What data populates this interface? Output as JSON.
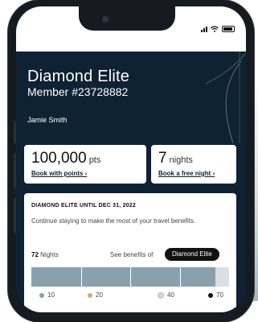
{
  "member": {
    "tier_name": "Diamond Elite",
    "member_number": "Member #23728882",
    "name": "Jamie Smith"
  },
  "points_card": {
    "value": "100,000",
    "unit": "pts",
    "link_label": "Book with points ›"
  },
  "nights_card": {
    "value": "7",
    "unit": "nights",
    "link_label": "Book a free night ›"
  },
  "benefits": {
    "title": "DIAMOND ELITE UNTIL DEC 31, 2022",
    "description": "Continue staying to make the most of your travel benefits.",
    "nights_value": "72",
    "nights_label": "Nights",
    "see_benefits_label": "See benefits of",
    "selected_tier": "Diamond Elite",
    "progress_fraction": 0.93,
    "tiers": [
      {
        "nights": "10",
        "color": "#8aa0ad"
      },
      {
        "nights": "20",
        "color": "#c9b27a"
      },
      {
        "nights": "40",
        "color": "#d3d7da"
      },
      {
        "nights": "70",
        "color": "#111111"
      }
    ]
  },
  "colors": {
    "hero_background": "#0e2233",
    "card_background": "#ffffff"
  },
  "icons": [
    "signal-icon",
    "wifi-icon",
    "battery-icon"
  ]
}
